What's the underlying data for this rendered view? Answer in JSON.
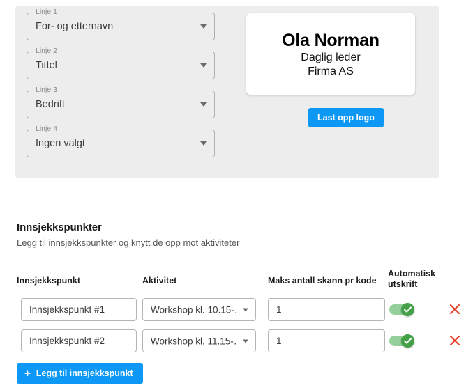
{
  "badge_panel": {
    "fields": [
      {
        "label": "Linje 1",
        "value": "For- og etternavn",
        "caret": "chevron-down-icon"
      },
      {
        "label": "Linje 2",
        "value": "Tittel",
        "caret": "chevron-down-icon"
      },
      {
        "label": "Linje 3",
        "value": "Bedrift",
        "caret": "chevron-down-icon"
      },
      {
        "label": "Linje 4",
        "value": "Ingen valgt",
        "caret": "chevron-down-icon"
      }
    ],
    "preview": {
      "name": "Ola Norman",
      "title": "Daglig leder",
      "company": "Firma AS"
    },
    "upload_button": "Last opp logo",
    "background_color": "#ededed",
    "accent_color": "#0d98f5"
  },
  "checkpoints": {
    "heading": "Innsjekkspunkter",
    "subheading": "Legg til innsjekkspunkter og knytt de opp mot aktiviteter",
    "columns": {
      "name": "Innsjekkspunkt",
      "activity": "Aktivitet",
      "max_scans": "Maks antall skann pr kode",
      "auto_print": "Automatisk utskrift"
    },
    "rows": [
      {
        "name": "Innsjekkspunkt #1",
        "activity": "Workshop kl. 10.15-…",
        "max_scans": "1",
        "auto_print": true
      },
      {
        "name": "Innsjekkspunkt #2",
        "activity": "Workshop kl. 11.15-…",
        "max_scans": "1",
        "auto_print": true
      }
    ],
    "add_button": "Legg til innsjekkspunkt",
    "add_icon": "plus-icon",
    "delete_icon": "close-icon",
    "toggle_on_color": "#43a047",
    "delete_color": "#e8442c"
  }
}
